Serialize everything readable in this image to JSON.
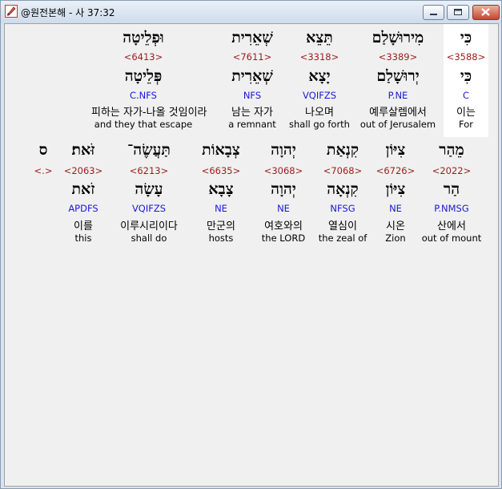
{
  "window": {
    "title": "@원전본해 - 사 37:32",
    "app_icon": "pen-icon",
    "minimize_icon": "minimize-icon",
    "maximize_icon": "maximize-icon",
    "close_icon": "close-icon"
  },
  "colors": {
    "strong_number": "#9b1c1c",
    "parsing": "#1a1ad0",
    "close_button": "#c7452c"
  },
  "verse": {
    "row1": [
      {
        "hebrew": "כִּי",
        "strong": "<3588>",
        "lemma": "כִּי",
        "parse": "C",
        "korean": "이는",
        "english": "For"
      },
      {
        "hebrew": "מִירוּשָׁלַם",
        "strong": "<3389>",
        "lemma": "יְרוּשָׁלַם",
        "parse": "P.NE",
        "korean": "예루살렘에서",
        "english": "out of Jerusalem"
      },
      {
        "hebrew": "תֵּצֵא",
        "strong": "<3318>",
        "lemma": "יָצָא",
        "parse": "VQIFZS",
        "korean": "나오며",
        "english": "shall go forth"
      },
      {
        "hebrew": "שְׁאֵרִית",
        "strong": "<7611>",
        "lemma": "שְׁאֵרִית",
        "parse": "NFS",
        "korean": "남는 자가",
        "english": "a remnant"
      },
      {
        "hebrew": "וּפְלֵיטָה",
        "strong": "<6413>",
        "lemma": "פְּלֵיטָה",
        "parse": "C.NFS",
        "korean": "피하는 자가-나올 것임이라",
        "english": "and they that escape"
      }
    ],
    "row2": [
      {
        "hebrew": "מֵהַר",
        "strong": "<2022>",
        "lemma": "הַר",
        "parse": "P.NMSG",
        "korean": "산에서",
        "english": "out of mount"
      },
      {
        "hebrew": "צִיּוֹן",
        "strong": "<6726>",
        "lemma": "צִיּוֹן",
        "parse": "NE",
        "korean": "시온",
        "english": "Zion"
      },
      {
        "hebrew": "קִנְאַת",
        "strong": "<7068>",
        "lemma": "קִנְאָה",
        "parse": "NFSG",
        "korean": "열심이",
        "english": "the zeal of"
      },
      {
        "hebrew": "יְהוָה",
        "strong": "<3068>",
        "lemma": "יְהוָה",
        "parse": "NE",
        "korean": "여호와의",
        "english": "the LORD"
      },
      {
        "hebrew": "צְבָאוֹת",
        "strong": "<6635>",
        "lemma": "צָבָא",
        "parse": "NE",
        "korean": "만군의",
        "english": "hosts"
      },
      {
        "hebrew": "תַּעֲשֶׂה־",
        "strong": "<6213>",
        "lemma": "עָשָׂה",
        "parse": "VQIFZS",
        "korean": "이루시리이다",
        "english": "shall do"
      },
      {
        "hebrew": "זֹּאת׃",
        "strong": "<2063>",
        "lemma": "זֹאת",
        "parse": "APDFS",
        "korean": "이를",
        "english": "this"
      },
      {
        "hebrew": "ס",
        "strong": "<.>",
        "lemma": "",
        "parse": "",
        "korean": "",
        "english": ""
      }
    ]
  }
}
